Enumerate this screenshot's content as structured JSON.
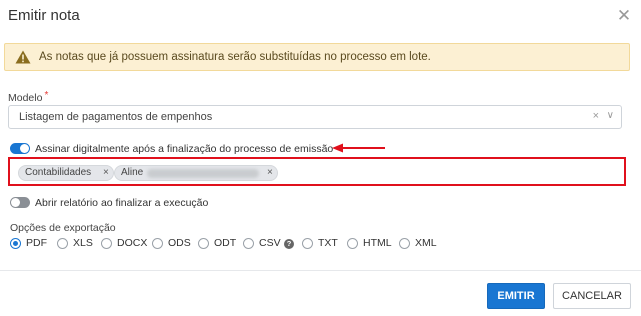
{
  "dialog": {
    "title": "Emitir nota",
    "close_icon": "close-icon"
  },
  "warning": {
    "icon": "warning-triangle-icon",
    "text": "As notas que já possuem assinatura serão substituídas no processo em lote.",
    "color": "#fcf0d3"
  },
  "modelo": {
    "label": "Modelo",
    "required_mark": "*",
    "value": "Listagem de pagamentos de empenhos",
    "clear_glyph": "×",
    "caret_glyph": "∨"
  },
  "assinar": {
    "label": "Assinar digitalmente após a finalização do processo de emissão",
    "enabled": true
  },
  "signers": {
    "tags": [
      {
        "label": "Contabilidades",
        "remove_glyph": "×"
      },
      {
        "label": "Aline",
        "remove_glyph": "×"
      }
    ]
  },
  "relatorio": {
    "label": "Abrir relatório ao finalizar a execução",
    "enabled": false
  },
  "export": {
    "label": "Opções de exportação",
    "selected": "PDF",
    "options": [
      "PDF",
      "XLS",
      "DOCX",
      "ODS",
      "ODT",
      "CSV",
      "TXT",
      "HTML",
      "XML"
    ],
    "help_glyph": "?"
  },
  "footer": {
    "emitir_label": "EMITIR",
    "cancelar_label": "CANCELAR"
  },
  "colors": {
    "accent": "#1976d2",
    "highlight_border": "#e0101c",
    "required": "#e53935"
  }
}
